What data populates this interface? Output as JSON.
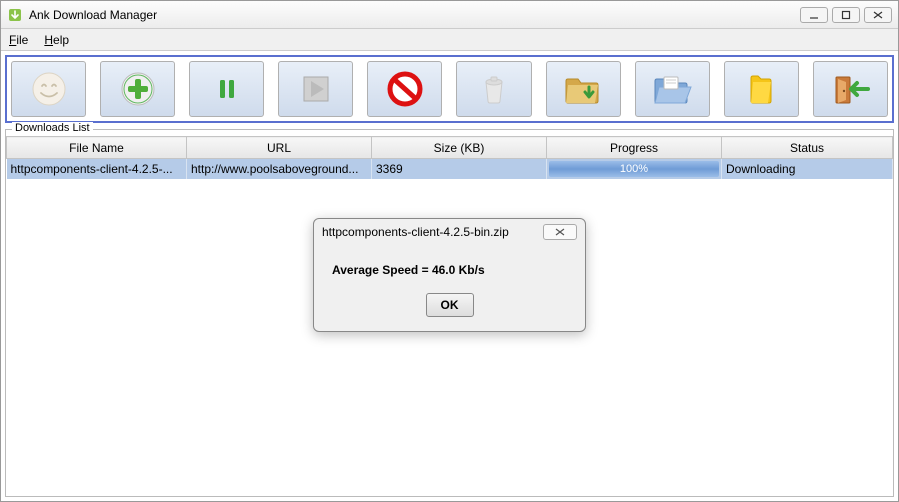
{
  "app": {
    "title": "Ank Download Manager"
  },
  "menu": {
    "file": "File",
    "help": "Help"
  },
  "group_label": "Downloads List",
  "columns": {
    "filename": "File Name",
    "url": "URL",
    "size": "Size (KB)",
    "progress": "Progress",
    "status": "Status"
  },
  "rows": [
    {
      "filename": "httpcomponents-client-4.2.5-...",
      "url": "http://www.poolsaboveground...",
      "size": "3369",
      "progress": "100%",
      "status": "Downloading"
    }
  ],
  "dialog": {
    "title": "httpcomponents-client-4.2.5-bin.zip",
    "message": "Average Speed = 46.0 Kb/s",
    "ok": "OK"
  }
}
